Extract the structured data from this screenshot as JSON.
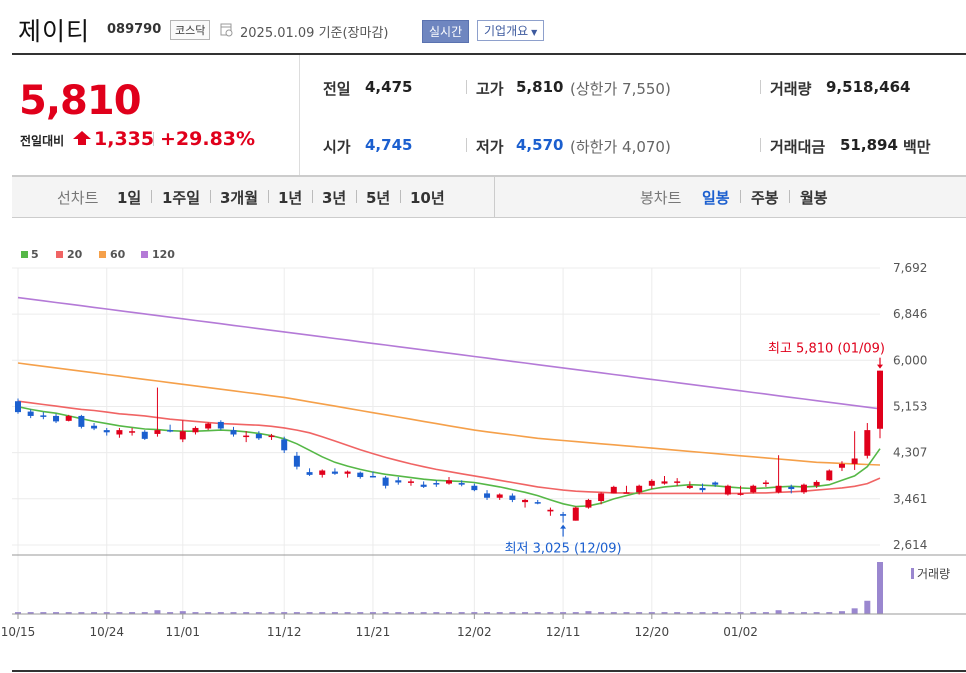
{
  "header": {
    "name": "제이티",
    "code": "089790",
    "market": "코스닥",
    "date_text": "2025.01.09 기준(장마감)",
    "realtime_label": "실시간",
    "company_label": "기업개요"
  },
  "price": {
    "current": "5,810",
    "change_label": "전일대비",
    "change_value": "1,335",
    "change_pct": "+29.83%"
  },
  "stats": {
    "prev_label": "전일",
    "prev_value": "4,475",
    "high_label": "고가",
    "high_value": "5,810",
    "upper_limit": "(상한가 7,550)",
    "volume_label": "거래량",
    "volume_value": "9,518,464",
    "open_label": "시가",
    "open_value": "4,745",
    "low_label": "저가",
    "low_value": "4,570",
    "lower_limit": "(하한가 4,070)",
    "amount_label": "거래대금",
    "amount_value": "51,894",
    "amount_unit": "백만"
  },
  "periods": {
    "line_chart_label": "선차트",
    "items": [
      "1일",
      "1주일",
      "3개월",
      "1년",
      "3년",
      "5년",
      "10년"
    ],
    "candle_label": "봉차트",
    "candle_items": [
      "일봉",
      "주봉",
      "월봉"
    ],
    "active_candle": "일봉"
  },
  "colors": {
    "up": "#e0001b",
    "down": "#1b5fcf",
    "ma5": "#56b847",
    "ma20": "#f06464",
    "ma60": "#f5a04a",
    "ma120": "#b47ad7",
    "volume": "#9a87cf"
  },
  "chart_data": {
    "type": "candlestick",
    "legend": [
      {
        "name": "5",
        "color": "#56b847"
      },
      {
        "name": "20",
        "color": "#f06464"
      },
      {
        "name": "60",
        "color": "#f5a04a"
      },
      {
        "name": "120",
        "color": "#b47ad7"
      }
    ],
    "y_ticks": [
      "7,692",
      "6,846",
      "6,000",
      "5,153",
      "4,307",
      "3,461",
      "2,614"
    ],
    "ylim": [
      2614,
      7692
    ],
    "x_ticks": [
      "10/15",
      "10/24",
      "11/01",
      "11/12",
      "11/21",
      "12/02",
      "12/11",
      "12/20",
      "01/02"
    ],
    "x_tick_index": [
      0,
      7,
      13,
      21,
      28,
      36,
      43,
      50,
      57
    ],
    "annotations": {
      "high": "최고 5,810 (01/09)",
      "low": "최저 3,025 (12/09)"
    },
    "volume_label": "거래량",
    "candles": [
      [
        5250,
        5300,
        5020,
        5050
      ],
      [
        5060,
        5100,
        4940,
        4980
      ],
      [
        4990,
        5050,
        4920,
        4970
      ],
      [
        4980,
        5020,
        4850,
        4880
      ],
      [
        4890,
        5000,
        4880,
        4980
      ],
      [
        4980,
        5000,
        4750,
        4780
      ],
      [
        4800,
        4850,
        4720,
        4750
      ],
      [
        4720,
        4760,
        4620,
        4680
      ],
      [
        4640,
        4760,
        4580,
        4720
      ],
      [
        4680,
        4760,
        4620,
        4700
      ],
      [
        4690,
        4720,
        4540,
        4560
      ],
      [
        4650,
        5500,
        4600,
        4720
      ],
      [
        4720,
        4820,
        4680,
        4700
      ],
      [
        4550,
        4900,
        4500,
        4700
      ],
      [
        4680,
        4790,
        4640,
        4760
      ],
      [
        4750,
        4860,
        4720,
        4840
      ],
      [
        4870,
        4900,
        4720,
        4750
      ],
      [
        4720,
        4780,
        4600,
        4640
      ],
      [
        4600,
        4700,
        4500,
        4620
      ],
      [
        4650,
        4700,
        4540,
        4570
      ],
      [
        4600,
        4650,
        4540,
        4620
      ],
      [
        4550,
        4600,
        4300,
        4350
      ],
      [
        4250,
        4320,
        4000,
        4050
      ],
      [
        3950,
        4020,
        3880,
        3900
      ],
      [
        3900,
        4000,
        3850,
        3980
      ],
      [
        3960,
        4020,
        3900,
        3920
      ],
      [
        3920,
        3980,
        3850,
        3960
      ],
      [
        3940,
        3960,
        3830,
        3860
      ],
      [
        3880,
        3960,
        3850,
        3860
      ],
      [
        3850,
        3880,
        3650,
        3700
      ],
      [
        3800,
        3860,
        3720,
        3760
      ],
      [
        3760,
        3820,
        3700,
        3780
      ],
      [
        3720,
        3780,
        3660,
        3680
      ],
      [
        3750,
        3800,
        3680,
        3740
      ],
      [
        3740,
        3860,
        3720,
        3800
      ],
      [
        3750,
        3800,
        3690,
        3720
      ],
      [
        3700,
        3740,
        3600,
        3620
      ],
      [
        3560,
        3620,
        3440,
        3480
      ],
      [
        3480,
        3560,
        3440,
        3540
      ],
      [
        3520,
        3560,
        3400,
        3440
      ],
      [
        3400,
        3460,
        3300,
        3440
      ],
      [
        3400,
        3440,
        3360,
        3380
      ],
      [
        3230,
        3300,
        3150,
        3260
      ],
      [
        3180,
        3220,
        3025,
        3150
      ],
      [
        3060,
        3320,
        3060,
        3300
      ],
      [
        3300,
        3460,
        3280,
        3440
      ],
      [
        3420,
        3580,
        3360,
        3560
      ],
      [
        3560,
        3700,
        3560,
        3680
      ],
      [
        3560,
        3700,
        3560,
        3580
      ],
      [
        3580,
        3720,
        3540,
        3700
      ],
      [
        3700,
        3820,
        3640,
        3790
      ],
      [
        3740,
        3880,
        3720,
        3780
      ],
      [
        3760,
        3840,
        3700,
        3780
      ],
      [
        3660,
        3780,
        3640,
        3700
      ],
      [
        3660,
        3740,
        3580,
        3620
      ],
      [
        3760,
        3780,
        3680,
        3720
      ],
      [
        3540,
        3720,
        3520,
        3700
      ],
      [
        3560,
        3700,
        3520,
        3560
      ],
      [
        3580,
        3720,
        3560,
        3700
      ],
      [
        3740,
        3800,
        3680,
        3760
      ],
      [
        3580,
        4260,
        3560,
        3700
      ],
      [
        3680,
        3720,
        3560,
        3640
      ],
      [
        3580,
        3740,
        3550,
        3720
      ],
      [
        3700,
        3800,
        3660,
        3770
      ],
      [
        3800,
        4000,
        3790,
        3980
      ],
      [
        4030,
        4150,
        3970,
        4100
      ],
      [
        4100,
        4700,
        3990,
        4200
      ],
      [
        4250,
        4850,
        4200,
        4720
      ],
      [
        4745,
        5810,
        4570,
        5810
      ]
    ],
    "volume": [
      2,
      2,
      2,
      2,
      2,
      2,
      2,
      2,
      2,
      2,
      2,
      4,
      2,
      3,
      2,
      2,
      2,
      2,
      2,
      2,
      2,
      2,
      2,
      2,
      2,
      2,
      2,
      2,
      2,
      2,
      2,
      2,
      2,
      2,
      2,
      2,
      2,
      2,
      2,
      2,
      2,
      2,
      2,
      2,
      2,
      3,
      2,
      2,
      2,
      2,
      2,
      2,
      2,
      2,
      2,
      2,
      2,
      2,
      2,
      2,
      4,
      2,
      2,
      2,
      2,
      3,
      6,
      14,
      55
    ],
    "ma5": [
      5150,
      5100,
      5060,
      5030,
      4980,
      4930,
      4880,
      4840,
      4800,
      4770,
      4740,
      4730,
      4710,
      4700,
      4700,
      4710,
      4720,
      4710,
      4690,
      4660,
      4620,
      4560,
      4470,
      4350,
      4230,
      4130,
      4060,
      4000,
      3950,
      3910,
      3880,
      3850,
      3820,
      3800,
      3790,
      3780,
      3760,
      3720,
      3680,
      3630,
      3580,
      3520,
      3440,
      3370,
      3320,
      3330,
      3380,
      3460,
      3520,
      3580,
      3640,
      3680,
      3700,
      3720,
      3710,
      3700,
      3680,
      3660,
      3650,
      3660,
      3680,
      3690,
      3680,
      3690,
      3720,
      3800,
      3880,
      4050,
      4380
    ],
    "ma20": [
      5250,
      5220,
      5190,
      5160,
      5130,
      5100,
      5080,
      5050,
      5020,
      5000,
      4980,
      4950,
      4920,
      4900,
      4880,
      4860,
      4840,
      4830,
      4820,
      4810,
      4790,
      4760,
      4720,
      4670,
      4600,
      4520,
      4440,
      4360,
      4290,
      4220,
      4160,
      4100,
      4050,
      4000,
      3960,
      3920,
      3880,
      3840,
      3800,
      3760,
      3720,
      3680,
      3650,
      3620,
      3600,
      3590,
      3580,
      3570,
      3570,
      3560,
      3560,
      3560,
      3560,
      3560,
      3560,
      3560,
      3560,
      3560,
      3570,
      3570,
      3580,
      3590,
      3600,
      3620,
      3640,
      3660,
      3690,
      3740,
      3840
    ],
    "ma60": [
      5950,
      5920,
      5890,
      5860,
      5830,
      5800,
      5770,
      5740,
      5710,
      5680,
      5650,
      5620,
      5590,
      5560,
      5530,
      5500,
      5470,
      5440,
      5410,
      5380,
      5350,
      5320,
      5280,
      5240,
      5200,
      5160,
      5120,
      5080,
      5040,
      5000,
      4960,
      4920,
      4880,
      4840,
      4800,
      4760,
      4720,
      4690,
      4660,
      4630,
      4600,
      4570,
      4550,
      4530,
      4510,
      4490,
      4470,
      4450,
      4430,
      4410,
      4390,
      4370,
      4350,
      4330,
      4310,
      4290,
      4270,
      4250,
      4230,
      4210,
      4190,
      4170,
      4150,
      4130,
      4120,
      4110,
      4100,
      4090,
      4080
    ],
    "ma120": [
      7150,
      7120,
      7090,
      7060,
      7030,
      7000,
      6970,
      6940,
      6910,
      6880,
      6850,
      6820,
      6790,
      6760,
      6730,
      6700,
      6670,
      6640,
      6610,
      6580,
      6550,
      6520,
      6490,
      6460,
      6430,
      6400,
      6370,
      6340,
      6310,
      6280,
      6250,
      6220,
      6190,
      6160,
      6130,
      6100,
      6070,
      6040,
      6010,
      5980,
      5950,
      5920,
      5890,
      5860,
      5830,
      5800,
      5770,
      5740,
      5710,
      5680,
      5650,
      5620,
      5590,
      5560,
      5530,
      5500,
      5470,
      5440,
      5410,
      5380,
      5350,
      5320,
      5290,
      5260,
      5230,
      5200,
      5170,
      5140,
      5110
    ]
  }
}
